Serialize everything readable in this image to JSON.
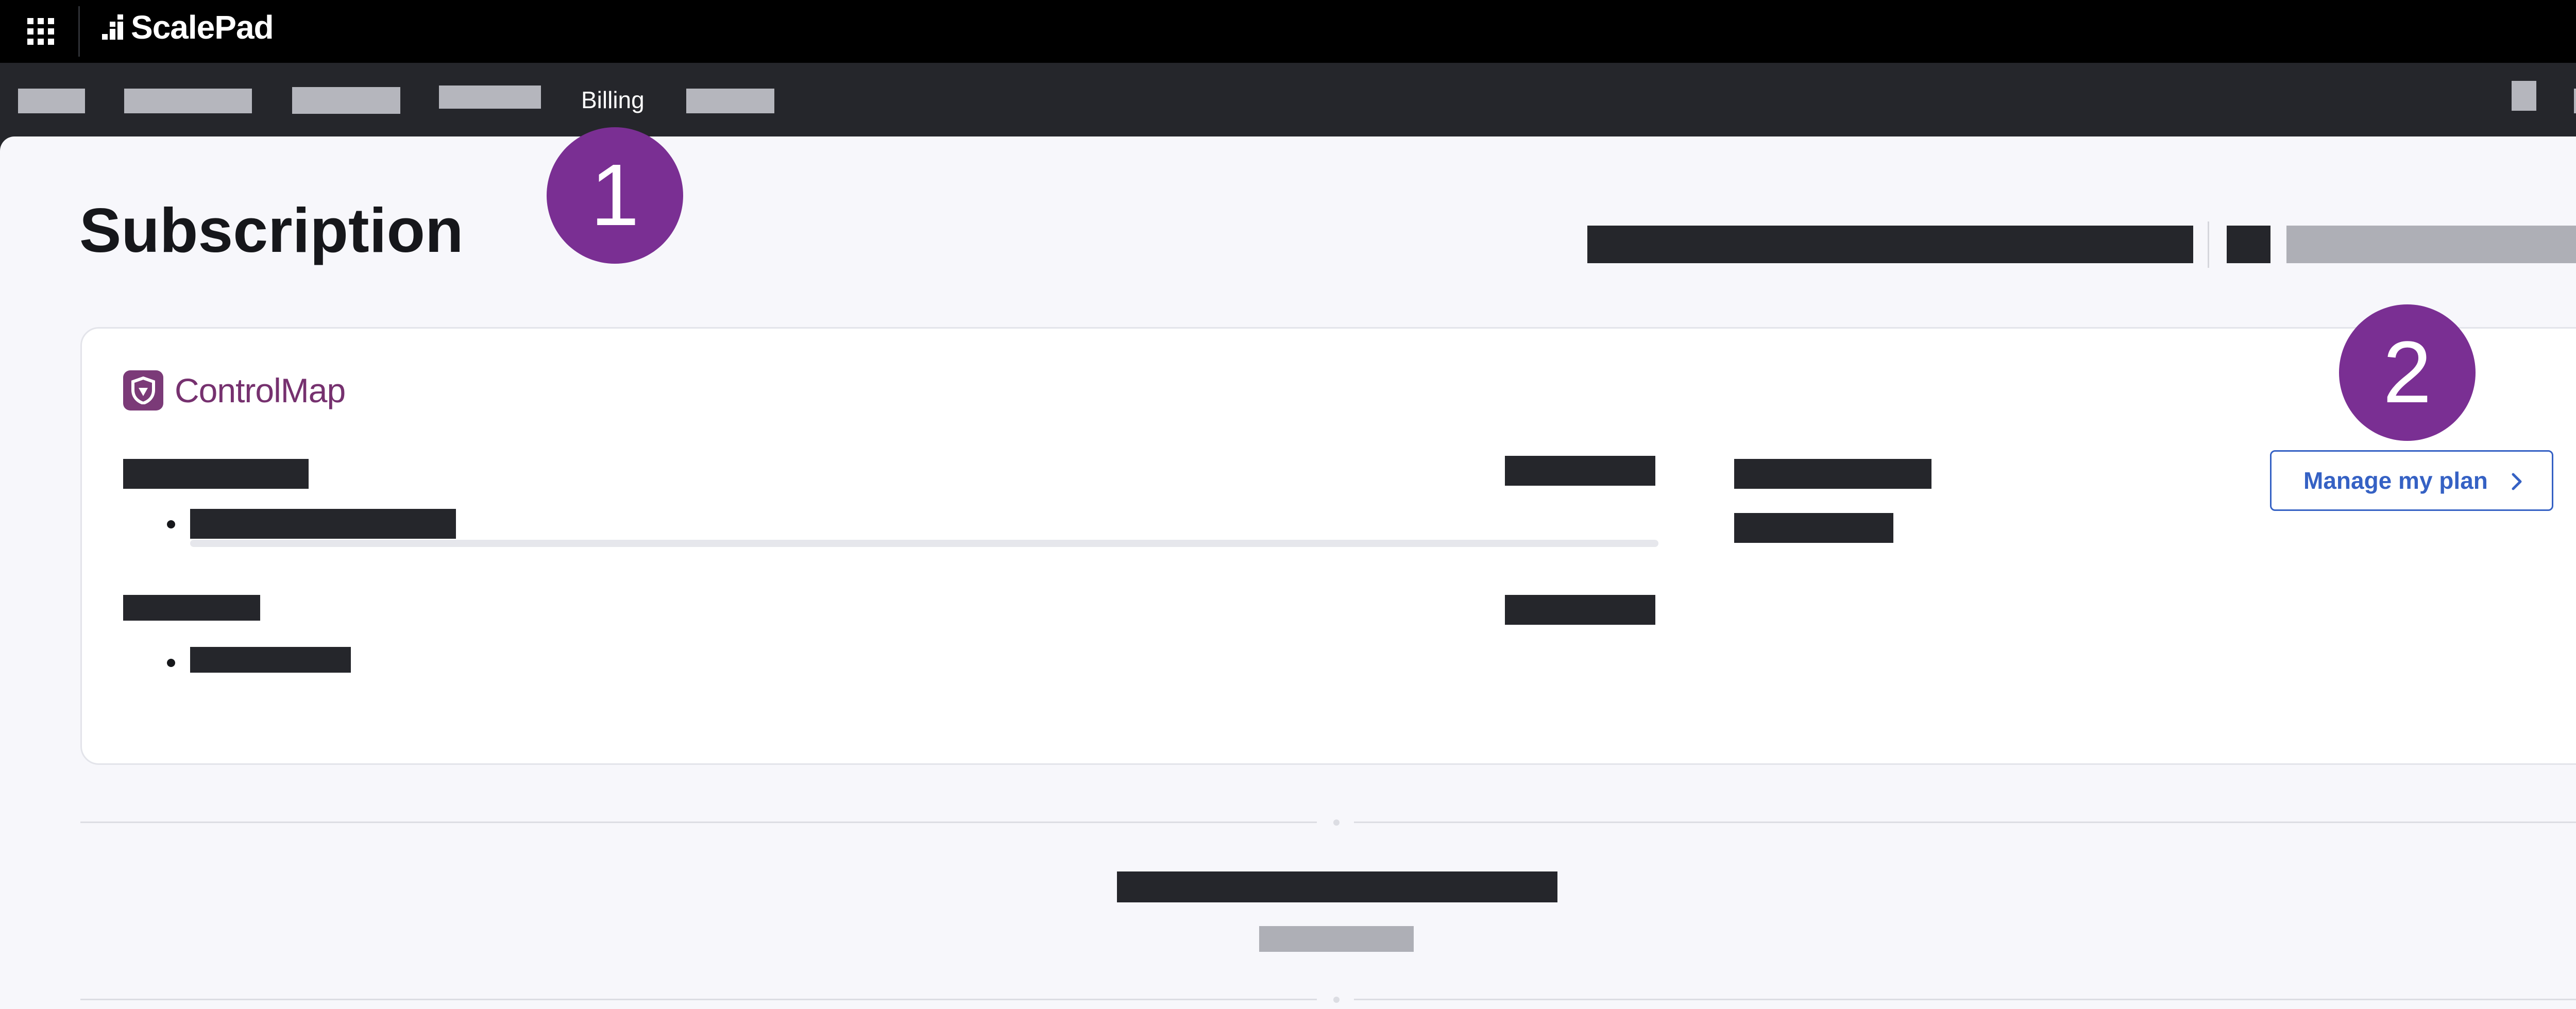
{
  "topbar": {
    "brand": "ScalePad",
    "icons": {
      "apps": "apps-grid-icon",
      "user": "user-icon"
    }
  },
  "nav": {
    "active_label": "Billing"
  },
  "page": {
    "title": "Subscription"
  },
  "card": {
    "product_logo_text": "ControlMap",
    "product_icon": "shield-icon",
    "manage_button_label": "Manage my plan",
    "manage_button_icon": "chevron-right-icon"
  },
  "markers": {
    "step1": "1",
    "step2": "2"
  },
  "colors": {
    "topbar": "#000000",
    "navbar": "#25262b",
    "page_bg": "#f7f7fb",
    "brand_purple": "#76316f",
    "marker_purple": "#7a2f93",
    "link_blue": "#3561c4",
    "redaction_dark": "#25262b",
    "redaction_gray": "#aeafb6"
  }
}
